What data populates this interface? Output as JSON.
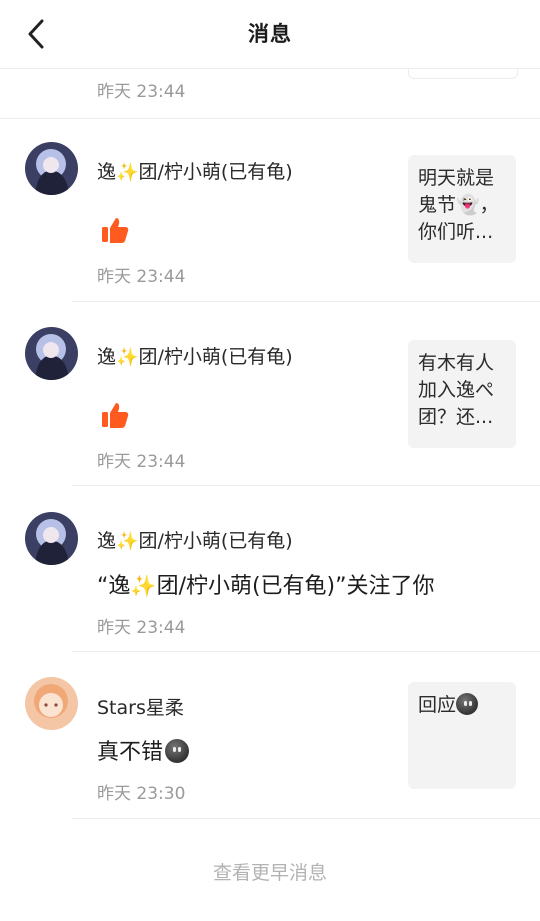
{
  "header": {
    "title": "消息",
    "back_icon": "chevron-left-icon"
  },
  "top_partial": {
    "time": "昨天 23:44"
  },
  "messages": [
    {
      "name_prefix": "逸",
      "name_suffix": "团/柠小萌(已有龟)",
      "action": "liked",
      "time": "昨天 23:44",
      "preview": "明天就是鬼节👻，你们听..."
    },
    {
      "name_prefix": "逸",
      "name_suffix": "团/柠小萌(已有龟)",
      "action": "liked",
      "time": "昨天 23:44",
      "preview": "有木有人加入逸ぺ团？还..."
    },
    {
      "name_prefix": "逸",
      "name_suffix": "团/柠小萌(已有龟)",
      "text_open": "“逸",
      "text_close": "团/柠小萌(已有龟)”关注了你",
      "time": "昨天 23:44"
    },
    {
      "name": "Stars星柔",
      "text": "真不错",
      "time": "昨天 23:30",
      "preview": "回应"
    }
  ],
  "footer": {
    "more_label": "查看更早消息"
  },
  "colors": {
    "accent": "#ff5a1f",
    "divider": "#ececec",
    "muted": "#9a9a9a"
  }
}
